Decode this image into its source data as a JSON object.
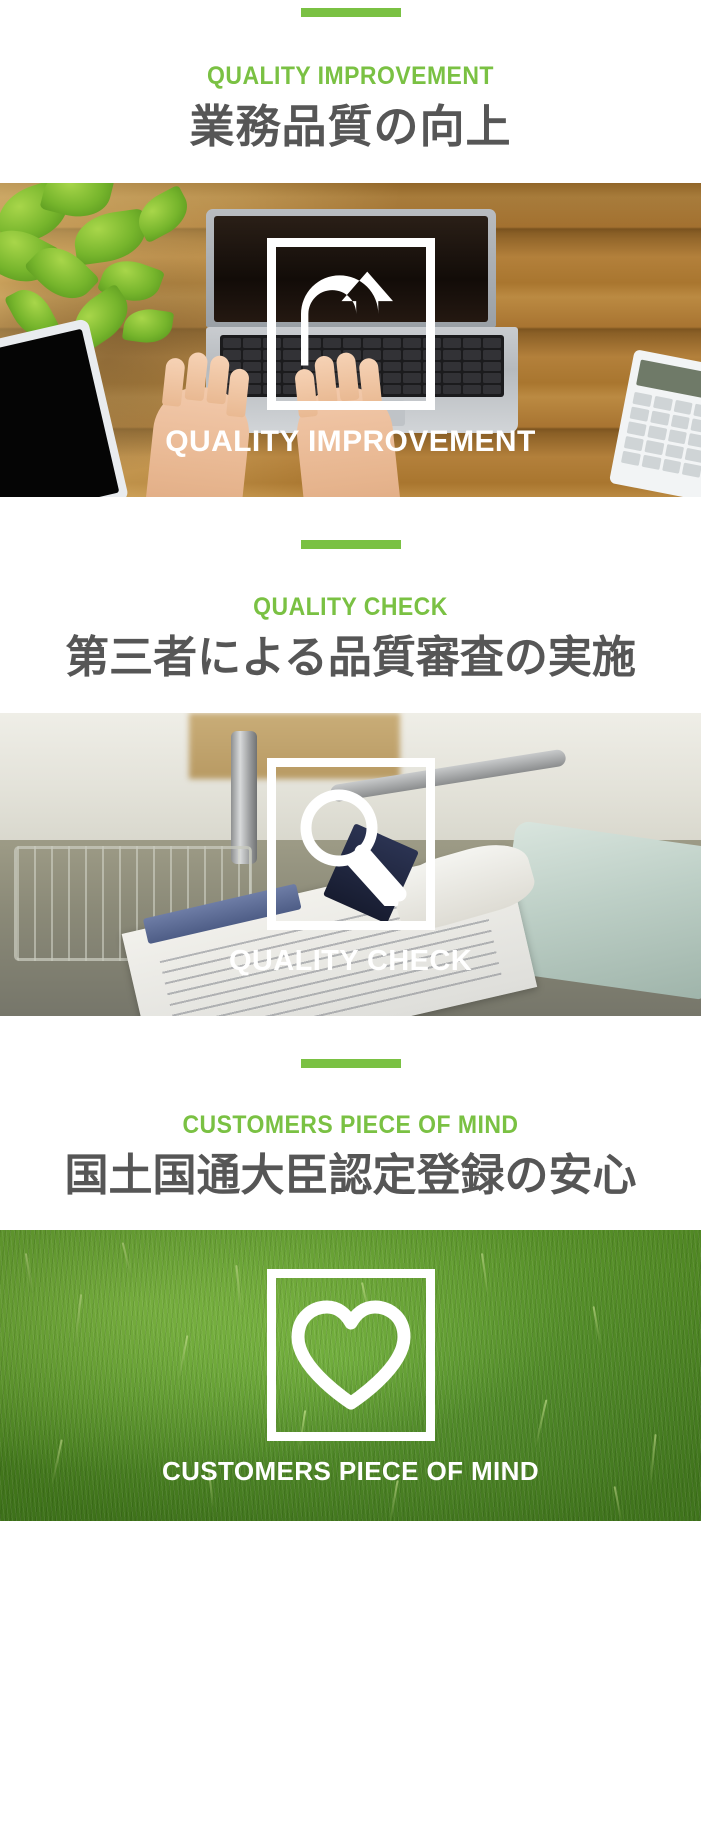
{
  "page": {
    "accent_green": "#7ac143",
    "heading_gray": "#565656",
    "caption_white": "#ffffff"
  },
  "sections": [
    {
      "id": "quality-improvement",
      "divider": "green-rule",
      "eyebrow": "QUALITY IMPROVEMENT",
      "heading": "業務品質の向上",
      "photo": {
        "scene": "wooden-desk-laptop-plant-tablet-calculator",
        "icon": "u-turn-arrow-icon",
        "caption": "QUALITY IMPROVEMENT"
      }
    },
    {
      "id": "quality-check",
      "divider": "green-rule",
      "eyebrow": "QUALITY CHECK",
      "heading": "第三者による品質審査の実施",
      "photo": {
        "scene": "inspection-clipboard-faucet-gloved-hand",
        "icon": "magnifier-icon",
        "caption": "QUALITY CHECK"
      }
    },
    {
      "id": "customers-piece-of-mind",
      "divider": "green-rule",
      "eyebrow": "CUSTOMERS PIECE OF MIND",
      "heading": "国土国通大臣認定登録の安心",
      "photo": {
        "scene": "green-grass-lawn",
        "icon": "heart-icon",
        "caption": "CUSTOMERS PIECE OF MIND"
      }
    }
  ]
}
